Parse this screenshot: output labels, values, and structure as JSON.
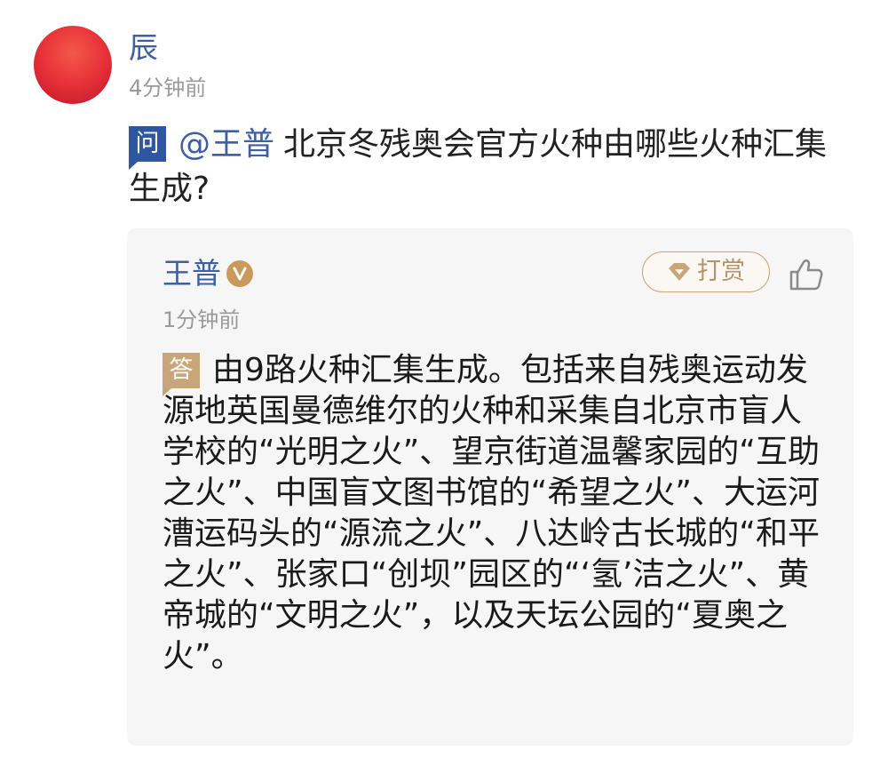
{
  "post": {
    "author_name": "辰",
    "time": "4分钟前",
    "avatar_color": "#e9343a"
  },
  "question": {
    "badge": "问",
    "mention": "@王普",
    "text": "北京冬残奥会官方火种由哪些火种汇集生成?"
  },
  "answer": {
    "author_name": "王普",
    "verified_badge_icon": "v-verified-icon",
    "tip_icon": "diamond-icon",
    "tip_label": "打赏",
    "like_icon": "thumbs-up-icon",
    "time": "1分钟前",
    "badge": "答",
    "text": "由9路火种汇集生成。包括来自残奥运动发源地英国曼德维尔的火种和采集自北京市盲人学校的“光明之火”、望京街道温馨家园的“互助之火”、中国盲文图书馆的“希望之火”、大运河漕运码头的“源流之火”、八达岭古长城的“和平之火”、张家口“创坝”园区的“‘氢’洁之火”、黄帝城的“文明之火”，以及天坛公园的“夏奥之火”。"
  },
  "colors": {
    "name_blue": "#3d5fa6",
    "question_badge": "#2f56a0",
    "answer_badge": "#c9a57a",
    "card_background": "#f6f6f6",
    "meta_gray": "#9a9a9a"
  }
}
